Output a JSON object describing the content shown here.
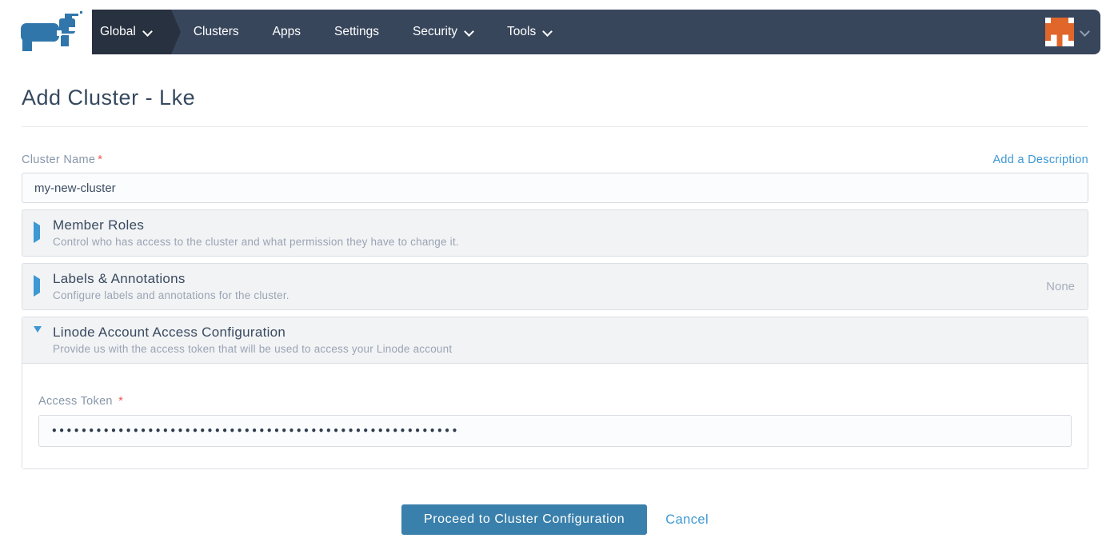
{
  "nav": {
    "items": [
      {
        "label": "Global",
        "caret": true,
        "active": true
      },
      {
        "label": "Clusters",
        "caret": false,
        "active": false
      },
      {
        "label": "Apps",
        "caret": false,
        "active": false
      },
      {
        "label": "Settings",
        "caret": false,
        "active": false
      },
      {
        "label": "Security",
        "caret": true,
        "active": false
      },
      {
        "label": "Tools",
        "caret": true,
        "active": false
      }
    ]
  },
  "page": {
    "title": "Add Cluster - Lke"
  },
  "form": {
    "cluster_name": {
      "label": "Cluster Name",
      "required_marker": "*",
      "value": "my-new-cluster"
    },
    "add_description_link": "Add a Description",
    "accordions": [
      {
        "title": "Member Roles",
        "subtitle": "Control who has access to the cluster and what permission they have to change it.",
        "state": "collapsed",
        "right_text": ""
      },
      {
        "title": "Labels & Annotations",
        "subtitle": "Configure labels and annotations for the cluster.",
        "state": "collapsed",
        "right_text": "None"
      },
      {
        "title": "Linode Account Access Configuration",
        "subtitle": "Provide us with the access token that will be used to access your Linode account",
        "state": "expanded"
      }
    ],
    "access_token": {
      "label": "Access Token",
      "required_marker": "*",
      "masked_value": "•••••••••••••••••••••••••••••••••••••••••••••••••••••••"
    }
  },
  "footer": {
    "proceed_label": "Proceed to Cluster Configuration",
    "cancel_label": "Cancel"
  },
  "colors": {
    "navbar": "#38465c",
    "navbar_active": "#27313f",
    "logo_blue": "#3076ab",
    "avatar_orange": "#e0662a",
    "link_blue": "#3d98d3",
    "button_blue": "#3a80ac",
    "required_red": "#f0564d",
    "accordion_bg": "#f2f3f5"
  }
}
